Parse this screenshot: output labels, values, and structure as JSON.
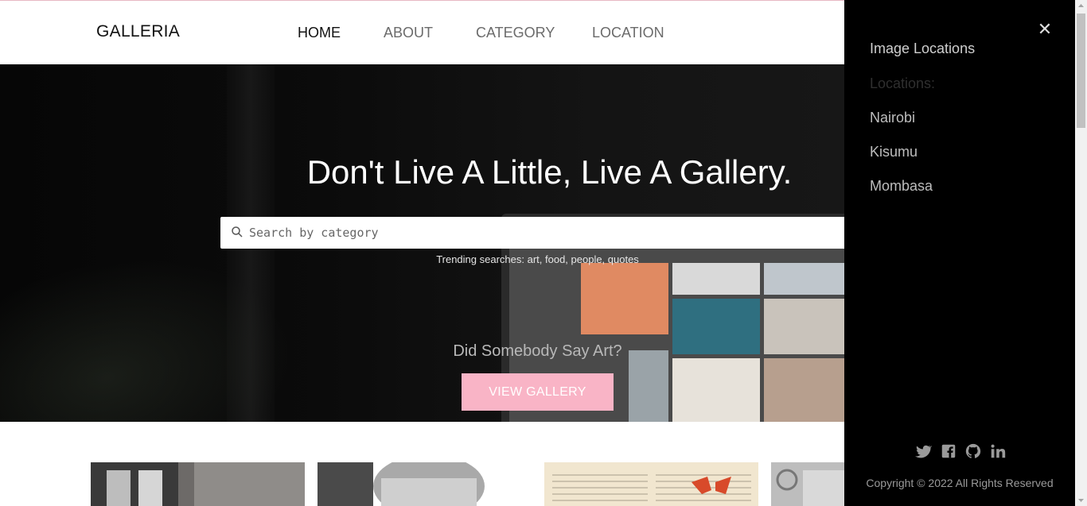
{
  "nav": {
    "brand": "GALLERIA",
    "links": [
      "HOME",
      "ABOUT",
      "CATEGORY",
      "LOCATION"
    ],
    "active": "HOME"
  },
  "hero": {
    "title": "Don't Live A Little, Live A Gallery.",
    "search_placeholder": "Search by category",
    "trending": "Trending searches: art, food, people, quotes",
    "tagline": "Did Somebody Say Art?",
    "button_label": "VIEW GALLERY"
  },
  "sidebar": {
    "close_icon": "close-icon",
    "title": "Image Locations",
    "subtitle": "Locations:",
    "locations": [
      "Nairobi",
      "Kisumu",
      "Mombasa"
    ],
    "social_icons": [
      "twitter-icon",
      "facebook-icon",
      "github-icon",
      "linkedin-icon"
    ],
    "copyright": "Copyright © 2022 All Rights Reserved"
  },
  "colors": {
    "accent_pink": "#f9b4c6",
    "sidebar_bg": "#000000",
    "nav_active": "#111111",
    "nav_inactive": "#6b6b6b"
  }
}
